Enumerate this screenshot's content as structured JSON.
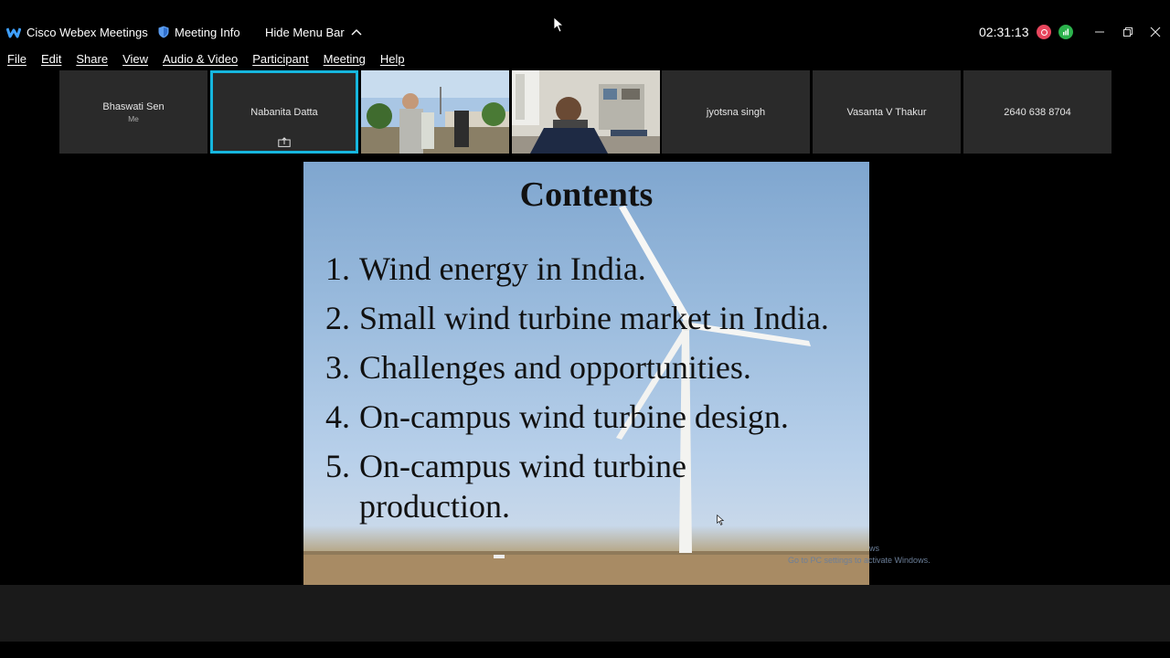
{
  "app": {
    "title": "Cisco Webex Meetings",
    "meeting_info": "Meeting Info",
    "hide_menu_bar": "Hide Menu Bar",
    "timer": "02:31:13",
    "colors": {
      "accent_active": "#16b6de",
      "record": "#e8465d",
      "stats": "#2bb24c"
    }
  },
  "menu": [
    "File",
    "Edit",
    "Share",
    "View",
    "Audio & Video",
    "Participant",
    "Meeting",
    "Help"
  ],
  "participants": [
    {
      "name": "Bhaswati Sen",
      "sub": "Me",
      "type": "placeholder"
    },
    {
      "name": "Nabanita Datta",
      "sub": "",
      "type": "placeholder",
      "active": true,
      "sharing": true
    },
    {
      "name": "",
      "type": "video"
    },
    {
      "name": "",
      "type": "video"
    },
    {
      "name": "jyotsna singh",
      "type": "placeholder"
    },
    {
      "name": "Vasanta V Thakur",
      "type": "placeholder"
    },
    {
      "name": "2640 638 8704",
      "type": "placeholder"
    }
  ],
  "slide": {
    "title": "Contents",
    "items": [
      {
        "num": "1.",
        "text": "Wind energy in India."
      },
      {
        "num": "2.",
        "text": "Small wind turbine market in India."
      },
      {
        "num": "3.",
        "text": "Challenges and opportunities."
      },
      {
        "num": "4.",
        "text": "On-campus wind turbine design."
      },
      {
        "num": "5.",
        "text": "On-campus wind turbine production."
      }
    ],
    "watermark_line1": "ws",
    "watermark_line2": "Go to PC settings to activate Windows."
  }
}
